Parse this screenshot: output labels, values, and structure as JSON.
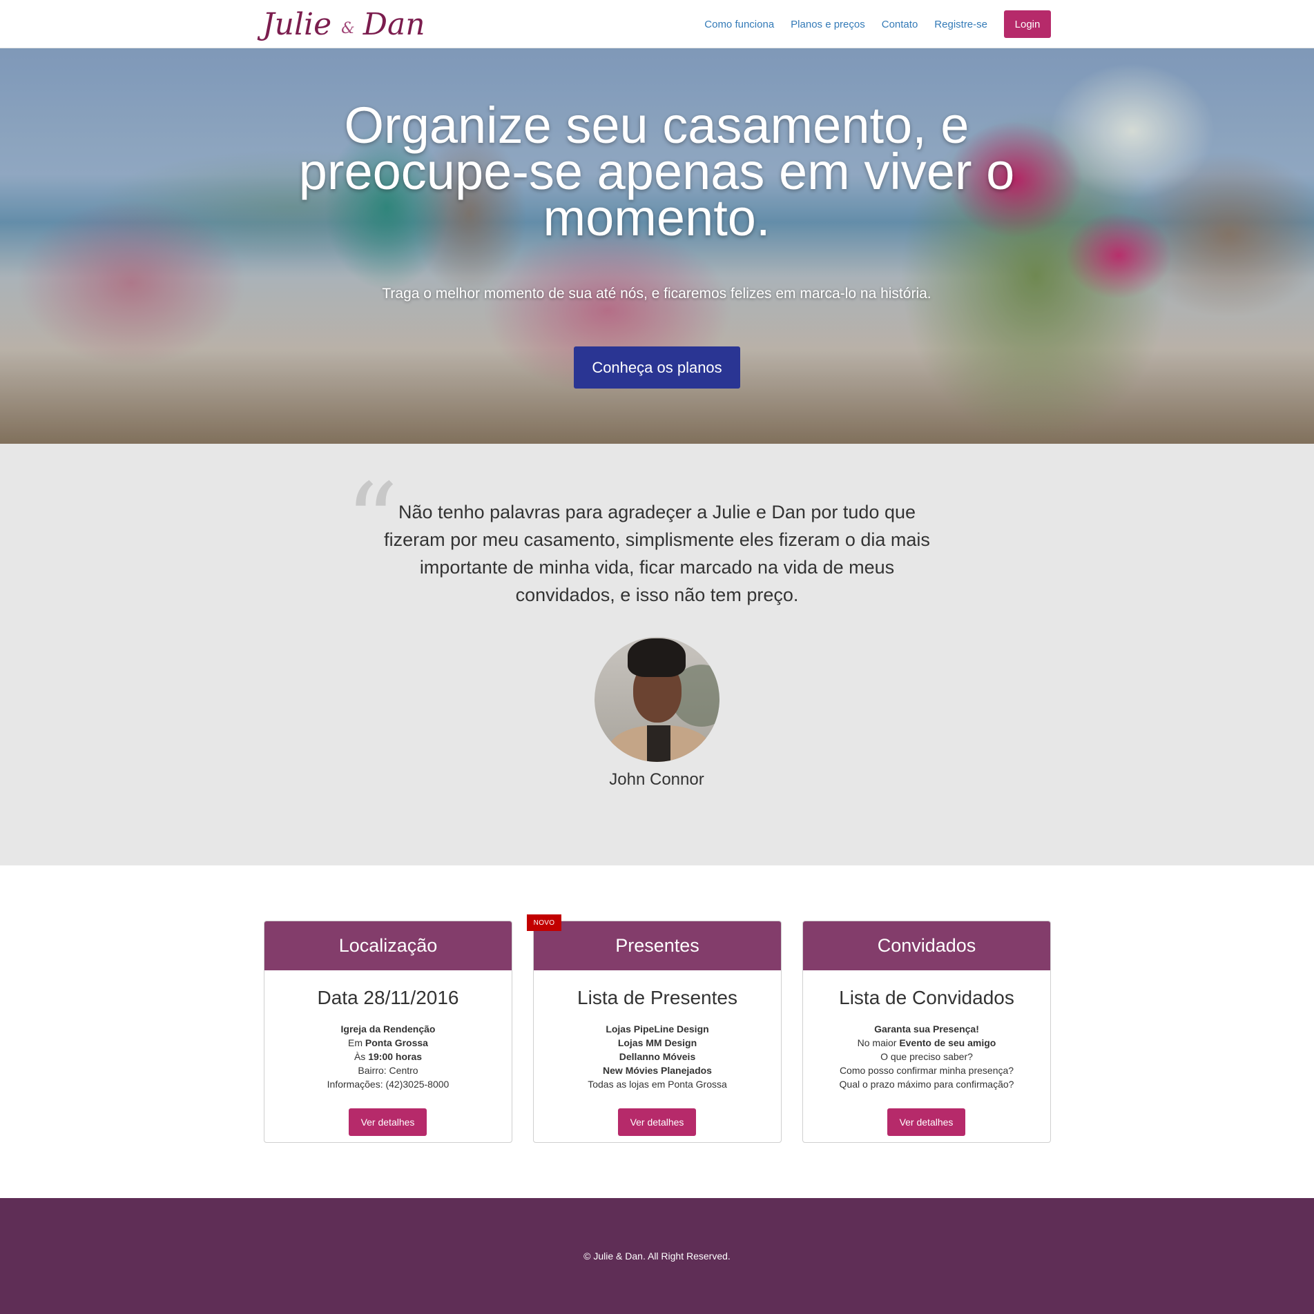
{
  "brand": {
    "first": "Julie",
    "amp": "&",
    "second": "Dan"
  },
  "nav": {
    "items": [
      "Como funciona",
      "Planos e preços",
      "Contato",
      "Registre-se"
    ],
    "login": "Login"
  },
  "hero": {
    "title": "Organize seu casamento, e preocupe-se apenas em viver o momento.",
    "subtitle": "Traga o melhor momento de sua até nós, e ficaremos felizes em marca-lo na história.",
    "cta": "Conheça os planos"
  },
  "testimonial": {
    "quote_mark": "“",
    "text": "Não tenho palavras para agradeçer a Julie e Dan por tudo que fizeram por meu casamento, simplismente eles fizeram o dia mais importante de minha vida, ficar marcado na vida de meus convidados, e isso não tem preço.",
    "author": "John Connor"
  },
  "cards": [
    {
      "header": "Localização",
      "title": "Data 28/11/2016",
      "badge": "",
      "lines": [
        {
          "pre": "",
          "bold": "Igreja da Rendenção",
          "post": ""
        },
        {
          "pre": "Em ",
          "bold": "Ponta Grossa",
          "post": ""
        },
        {
          "pre": "Às ",
          "bold": "19:00 horas",
          "post": ""
        },
        {
          "pre": "Bairro: Centro",
          "bold": "",
          "post": ""
        },
        {
          "pre": "Informações: (42)3025-8000",
          "bold": "",
          "post": ""
        }
      ],
      "button": "Ver detalhes"
    },
    {
      "header": "Presentes",
      "title": "Lista de Presentes",
      "badge": "NOVO",
      "lines": [
        {
          "pre": "",
          "bold": "Lojas PipeLine Design",
          "post": ""
        },
        {
          "pre": "",
          "bold": "Lojas MM Design",
          "post": ""
        },
        {
          "pre": "",
          "bold": "Dellanno Móveis",
          "post": ""
        },
        {
          "pre": "",
          "bold": "New Móvies Planejados",
          "post": ""
        },
        {
          "pre": "Todas as lojas em Ponta Grossa",
          "bold": "",
          "post": ""
        }
      ],
      "button": "Ver detalhes"
    },
    {
      "header": "Convidados",
      "title": "Lista de Convidados",
      "badge": "",
      "lines": [
        {
          "pre": "",
          "bold": "Garanta sua Presença!",
          "post": ""
        },
        {
          "pre": "No maior ",
          "bold": "Evento de seu amigo",
          "post": ""
        },
        {
          "pre": "O que preciso saber?",
          "bold": "",
          "post": ""
        },
        {
          "pre": "Como posso confirmar minha presença?",
          "bold": "",
          "post": ""
        },
        {
          "pre": "Qual o prazo máximo para confirmação?",
          "bold": "",
          "post": ""
        }
      ],
      "button": "Ver detalhes"
    }
  ],
  "footer": {
    "copyright": "© Julie & Dan. All Right Reserved."
  },
  "colors": {
    "brand": "#7b1d4e",
    "accent_button": "#b62a6a",
    "hero_button": "#2a3593",
    "card_header": "#833d6b",
    "badge": "#c20000",
    "footer": "#5f2e56",
    "link": "#337ab7"
  },
  "icons": {
    "quote": "quote-icon",
    "avatar": "avatar-photo"
  }
}
